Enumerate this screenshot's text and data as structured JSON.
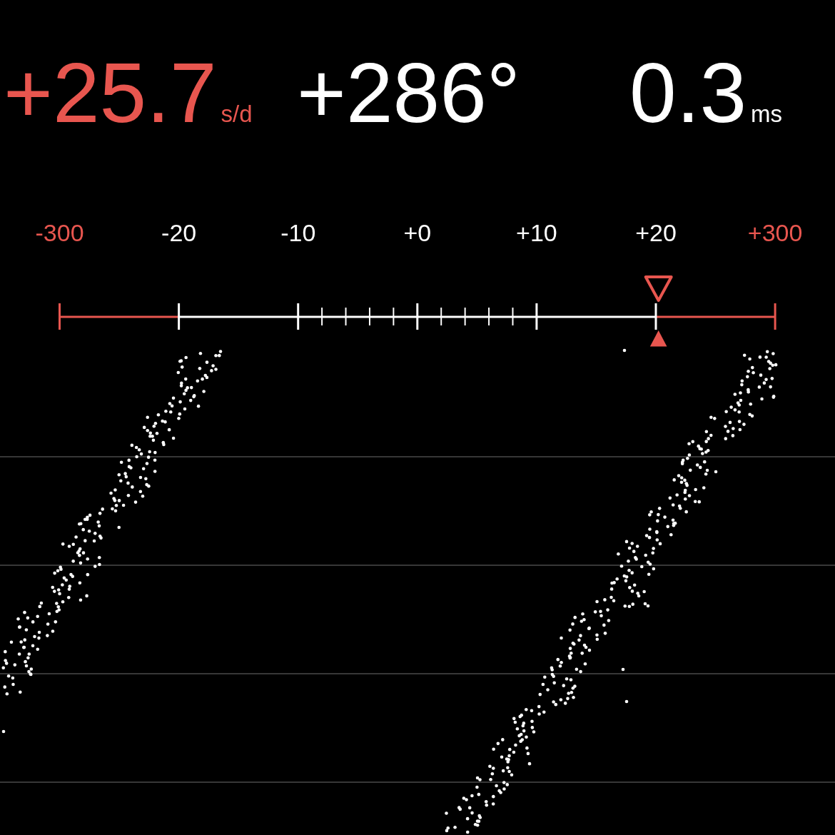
{
  "readings": [
    {
      "value": "+25.7",
      "unit": "s/d",
      "alert": true
    },
    {
      "value": "+286°",
      "alert": false
    },
    {
      "value": "0.3",
      "unit": "ms",
      "alert": false
    }
  ],
  "scale": {
    "labels": [
      {
        "text": "-300",
        "alert": true
      },
      {
        "text": "-20",
        "alert": false
      },
      {
        "text": "-10",
        "alert": false
      },
      {
        "text": "+0",
        "alert": false
      },
      {
        "text": "+10",
        "alert": false
      },
      {
        "text": "+20",
        "alert": false
      },
      {
        "text": "+300",
        "alert": true
      }
    ],
    "marker": {
      "level": 0.837
    }
  }
}
